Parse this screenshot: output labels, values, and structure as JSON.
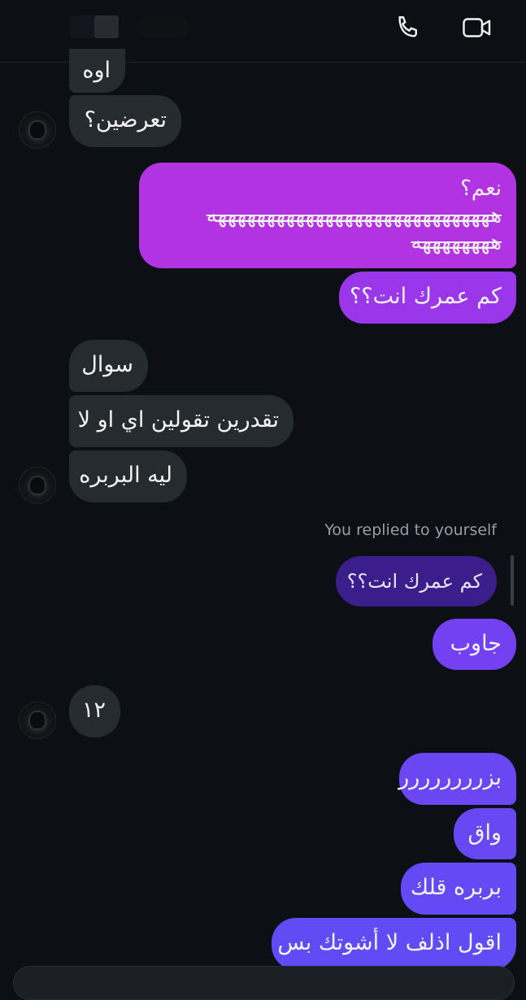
{
  "header": {
    "call_icon": "phone-icon",
    "video_icon": "video-camera-icon"
  },
  "messages": [
    {
      "dir": "in",
      "text": "اوه"
    },
    {
      "dir": "in",
      "text": "تعرضين؟"
    },
    {
      "dir": "out",
      "lines": [
        "نعم؟",
        "هههههههههههههههههههههههههههههه",
        "ههههههههه"
      ]
    },
    {
      "dir": "out",
      "text": "كم عمرك انت؟؟"
    },
    {
      "dir": "in",
      "text": "سوال"
    },
    {
      "dir": "in",
      "text": "تقدرين تقولين اي او لا"
    },
    {
      "dir": "in",
      "text": "ليه البربره"
    },
    {
      "dir": "out",
      "text": "جاوب"
    },
    {
      "dir": "in",
      "text": "١٢"
    },
    {
      "dir": "out",
      "text": "بزرررررررر"
    },
    {
      "dir": "out",
      "text": "واق"
    },
    {
      "dir": "out",
      "text": "بربره قلك"
    },
    {
      "dir": "out",
      "text": "اقول اذلف لا أشوتك بس"
    }
  ],
  "reply": {
    "note": "You replied to yourself",
    "quoted_text": "كم عمرك انت؟؟"
  },
  "colors": {
    "background": "#0c1014",
    "incoming_bubble": "#262b30",
    "outgoing_top": "#b832e0",
    "outgoing_bottom": "#6e4cf5",
    "reply_quote": "#3b1d8c"
  }
}
